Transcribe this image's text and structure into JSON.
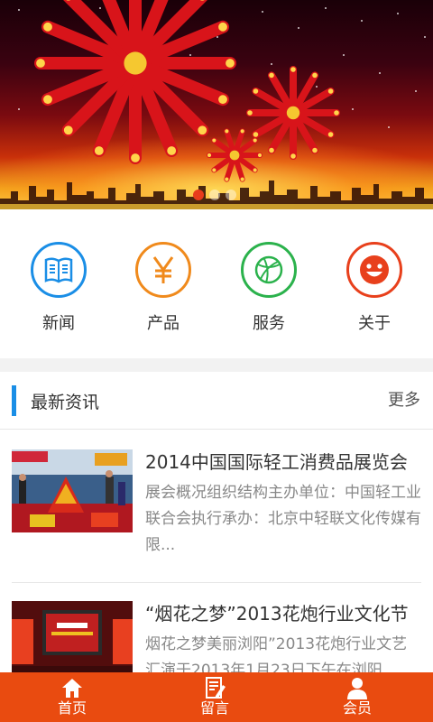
{
  "banner": {
    "carousel_count": 3,
    "active_index": 0,
    "colors": {
      "sky_top": "#1a0008",
      "sky_mid": "#7a0a10",
      "glow": "#ffd54a",
      "ribbon": "#d8141a",
      "ribbon_text": "#ffd54a"
    }
  },
  "categories": [
    {
      "label": "新闻",
      "icon": "newspaper-icon",
      "color": "#1a8ee6"
    },
    {
      "label": "产品",
      "icon": "yen-icon",
      "color": "#f08a1c"
    },
    {
      "label": "服务",
      "icon": "basketball-icon",
      "color": "#2bb24c"
    },
    {
      "label": "关于",
      "icon": "smiley-icon",
      "color": "#e8401c"
    }
  ],
  "news": {
    "header": "最新资讯",
    "more": "更多",
    "items": [
      {
        "title": "2014中国国际轻工消费品展览会",
        "desc": "展会概况组织结构主办单位：中国轻工业联合会执行承办：北京中轻联文化传媒有限..."
      },
      {
        "title": "“烟花之梦”2013花炮行业文化节",
        "desc": "烟花之梦美丽浏阳”2013花炮行业文艺汇演于2013年1月23日下午在浏阳"
      }
    ]
  },
  "bottom_nav": [
    {
      "label": "首页",
      "icon": "home-icon"
    },
    {
      "label": "留言",
      "icon": "message-icon"
    },
    {
      "label": "会员",
      "icon": "user-icon"
    }
  ],
  "accent_color": "#e94b10"
}
